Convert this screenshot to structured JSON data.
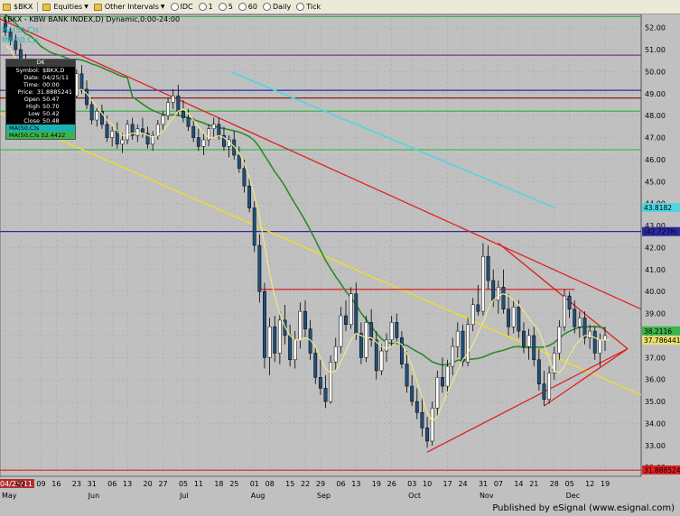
{
  "toolbar": {
    "symbol": "$BKX",
    "equities": "Equities",
    "other_intervals": "Other Intervals",
    "idc": "IDC",
    "i1": "1",
    "i5": "5",
    "i60": "60",
    "daily": "Daily",
    "tick": "Tick"
  },
  "chart_title": "$BKX - KBW BANK INDEX,D) Dynamic,0:00-24:00",
  "ma_labels": [
    "MA(50,C)s",
    "MA(50,C)s"
  ],
  "info_box": {
    "header": "DK",
    "rows": [
      {
        "label": "Symbol:",
        "value": "$BKX,D"
      },
      {
        "label": "Date:",
        "value": "04/25/11"
      },
      {
        "label": "Time:",
        "value": "00:00"
      },
      {
        "label": "Price:",
        "value": "31.8885241"
      },
      {
        "label": "Open",
        "value": "50.47"
      },
      {
        "label": "High",
        "value": "50.70"
      },
      {
        "label": "Low",
        "value": "50.42"
      },
      {
        "label": "Close",
        "value": "50.48"
      }
    ],
    "ma1": "MA(50,C)s",
    "ma2": "MA(50,C)s 52.4422"
  },
  "chart_data": {
    "type": "candlestick",
    "ylim": [
      31.6,
      52.6
    ],
    "y_ticks": [
      52.0,
      51.0,
      50.0,
      49.0,
      48.0,
      47.0,
      46.0,
      45.0,
      44.0,
      43.0,
      42.0,
      41.0,
      40.0,
      39.0,
      38.0,
      37.0,
      36.0,
      35.0,
      34.0,
      33.0,
      32.0
    ],
    "x_ticks": [
      "25",
      "02",
      "09",
      "16",
      "23",
      "31",
      "06",
      "13",
      "20",
      "27",
      "05",
      "11",
      "18",
      "25",
      "01",
      "08",
      "15",
      "22",
      "29",
      "06",
      "13",
      "19",
      "26",
      "03",
      "10",
      "17",
      "24",
      "31",
      "07",
      "14",
      "21",
      "28",
      "05",
      "12",
      "19"
    ],
    "x_tick_date_prefix": "04/25/11",
    "months": [
      {
        "label": "May",
        "tick_index": 0
      },
      {
        "label": "Jun",
        "tick_index": 5
      },
      {
        "label": "Jul",
        "tick_index": 10
      },
      {
        "label": "Aug",
        "tick_index": 14
      },
      {
        "label": "Sep",
        "tick_index": 18
      },
      {
        "label": "Oct",
        "tick_index": 23
      },
      {
        "label": "Nov",
        "tick_index": 27
      },
      {
        "label": "Dec",
        "tick_index": 32
      }
    ],
    "price_tags": [
      {
        "value": 42.7278,
        "label": "(42.7278)",
        "color": "#2a2aa5"
      },
      {
        "value": 38.2116,
        "label": "38.2116",
        "color": "#3bb449"
      },
      {
        "value": 37.786441,
        "label": "37.786441",
        "color": "#e8e070"
      },
      {
        "value": 31.888524,
        "label": "31.888524",
        "color": "#e02020"
      },
      {
        "value": 43.8182,
        "label": "43.8182",
        "color": "#4fd6e0"
      }
    ],
    "horizontal_lines": [
      {
        "value": 52.5,
        "color": "#3bb449"
      },
      {
        "value": 50.75,
        "color": "#7a3a7a"
      },
      {
        "value": 49.15,
        "color": "#2a2aa5"
      },
      {
        "value": 48.8,
        "color": "#8b2020"
      },
      {
        "value": 48.2,
        "color": "#3bb449"
      },
      {
        "value": 46.45,
        "color": "#3bb449"
      },
      {
        "value": 42.73,
        "color": "#2a2aa5"
      },
      {
        "value": 31.88,
        "color": "#e02020"
      }
    ],
    "colors": {
      "up_candle": "#ffffff",
      "down_candle": "#1f4f7a",
      "ma_short": "#f0e68c",
      "ma_long": "#2a8a2a",
      "ma_cyan": "#4fd6e0",
      "trend_red": "#e02020",
      "trend_yellow": "#f0e020",
      "plot_bg": "#c0c0c0",
      "grid": "#a8a8a8"
    },
    "candles": [
      [
        52.2,
        52.6,
        51.6,
        51.8
      ],
      [
        51.8,
        52.0,
        51.2,
        51.4
      ],
      [
        51.4,
        51.7,
        50.8,
        51.0
      ],
      [
        51.0,
        51.3,
        50.2,
        50.4
      ],
      [
        50.4,
        50.8,
        49.7,
        50.0
      ],
      [
        50.0,
        50.6,
        49.4,
        50.3
      ],
      [
        50.3,
        50.5,
        49.0,
        49.2
      ],
      [
        49.2,
        49.6,
        48.4,
        48.7
      ],
      [
        48.7,
        49.3,
        48.3,
        49.0
      ],
      [
        49.0,
        49.4,
        48.6,
        48.8
      ],
      [
        48.8,
        49.5,
        48.6,
        49.3
      ],
      [
        49.3,
        49.8,
        48.9,
        49.1
      ],
      [
        49.1,
        49.6,
        48.5,
        48.6
      ],
      [
        48.6,
        49.1,
        48.2,
        48.9
      ],
      [
        48.9,
        50.1,
        48.8,
        49.9
      ],
      [
        49.9,
        50.3,
        49.0,
        49.2
      ],
      [
        49.2,
        49.6,
        48.3,
        48.5
      ],
      [
        48.5,
        48.8,
        47.6,
        47.8
      ],
      [
        47.8,
        48.4,
        47.5,
        48.2
      ],
      [
        48.2,
        48.5,
        47.4,
        47.6
      ],
      [
        47.6,
        48.0,
        46.8,
        47.0
      ],
      [
        47.0,
        47.5,
        46.6,
        47.3
      ],
      [
        47.3,
        47.7,
        46.5,
        46.7
      ],
      [
        46.7,
        47.2,
        46.3,
        46.9
      ],
      [
        46.9,
        47.8,
        46.7,
        47.6
      ],
      [
        47.6,
        47.9,
        46.9,
        47.1
      ],
      [
        47.1,
        47.6,
        46.8,
        47.4
      ],
      [
        47.4,
        47.9,
        47.0,
        47.2
      ],
      [
        47.2,
        47.5,
        46.5,
        46.7
      ],
      [
        46.7,
        47.3,
        46.4,
        47.1
      ],
      [
        47.1,
        47.8,
        46.9,
        47.6
      ],
      [
        47.6,
        48.2,
        47.3,
        48.0
      ],
      [
        48.0,
        48.8,
        47.8,
        48.6
      ],
      [
        48.6,
        49.2,
        48.3,
        48.9
      ],
      [
        48.9,
        49.4,
        48.0,
        48.2
      ],
      [
        48.2,
        48.7,
        47.7,
        47.9
      ],
      [
        47.9,
        48.3,
        47.3,
        47.5
      ],
      [
        47.5,
        47.9,
        46.8,
        47.0
      ],
      [
        47.0,
        47.4,
        46.4,
        46.6
      ],
      [
        46.6,
        47.2,
        46.2,
        46.9
      ],
      [
        46.9,
        47.6,
        46.6,
        47.4
      ],
      [
        47.4,
        47.9,
        47.0,
        47.6
      ],
      [
        47.6,
        47.9,
        46.9,
        47.1
      ],
      [
        47.1,
        47.5,
        46.4,
        46.6
      ],
      [
        46.6,
        47.1,
        46.1,
        46.9
      ],
      [
        46.9,
        47.3,
        46.0,
        46.2
      ],
      [
        46.2,
        46.6,
        45.4,
        45.6
      ],
      [
        45.6,
        46.0,
        44.5,
        44.8
      ],
      [
        44.8,
        45.2,
        43.6,
        43.8
      ],
      [
        43.8,
        44.1,
        41.8,
        42.1
      ],
      [
        42.1,
        42.6,
        39.5,
        40.0
      ],
      [
        40.0,
        40.4,
        36.5,
        37.0
      ],
      [
        37.0,
        38.8,
        36.2,
        38.4
      ],
      [
        38.4,
        38.9,
        36.8,
        37.2
      ],
      [
        37.2,
        39.1,
        36.7,
        38.7
      ],
      [
        38.7,
        39.4,
        37.6,
        38.0
      ],
      [
        38.0,
        38.5,
        36.6,
        36.9
      ],
      [
        36.9,
        38.2,
        36.5,
        37.8
      ],
      [
        37.8,
        39.5,
        37.4,
        39.1
      ],
      [
        39.1,
        39.6,
        37.9,
        38.3
      ],
      [
        38.3,
        38.7,
        36.9,
        37.2
      ],
      [
        37.2,
        37.5,
        35.8,
        36.1
      ],
      [
        36.1,
        36.9,
        35.3,
        35.6
      ],
      [
        35.6,
        36.2,
        34.7,
        35.0
      ],
      [
        35.0,
        37.1,
        34.9,
        36.8
      ],
      [
        36.8,
        37.9,
        36.4,
        37.5
      ],
      [
        37.5,
        39.3,
        37.2,
        38.9
      ],
      [
        38.9,
        39.6,
        38.2,
        38.5
      ],
      [
        38.5,
        40.2,
        38.3,
        39.9
      ],
      [
        39.9,
        40.4,
        37.8,
        38.1
      ],
      [
        38.1,
        38.6,
        36.7,
        37.0
      ],
      [
        37.0,
        38.9,
        36.8,
        38.6
      ],
      [
        38.6,
        39.2,
        37.5,
        37.8
      ],
      [
        37.8,
        38.2,
        36.0,
        36.4
      ],
      [
        36.4,
        37.6,
        36.2,
        37.3
      ],
      [
        37.3,
        38.1,
        36.8,
        37.8
      ],
      [
        37.8,
        38.9,
        37.5,
        38.6
      ],
      [
        38.6,
        39.0,
        37.6,
        37.9
      ],
      [
        37.9,
        38.2,
        36.5,
        36.7
      ],
      [
        36.7,
        37.3,
        35.4,
        35.7
      ],
      [
        35.7,
        36.2,
        34.8,
        35.0
      ],
      [
        35.0,
        35.6,
        34.2,
        34.5
      ],
      [
        34.5,
        35.2,
        33.4,
        33.8
      ],
      [
        33.8,
        34.3,
        32.9,
        33.2
      ],
      [
        33.2,
        35.0,
        33.0,
        34.7
      ],
      [
        34.7,
        36.4,
        34.3,
        36.1
      ],
      [
        36.1,
        37.0,
        35.4,
        35.7
      ],
      [
        35.7,
        36.9,
        35.3,
        36.6
      ],
      [
        36.6,
        37.9,
        36.2,
        37.5
      ],
      [
        37.5,
        38.6,
        37.0,
        38.2
      ],
      [
        38.2,
        38.5,
        36.6,
        36.8
      ],
      [
        36.8,
        38.8,
        36.6,
        38.5
      ],
      [
        38.5,
        39.7,
        38.2,
        39.4
      ],
      [
        39.4,
        40.3,
        38.9,
        39.1
      ],
      [
        39.1,
        42.2,
        38.9,
        41.6
      ],
      [
        41.6,
        42.1,
        40.1,
        40.5
      ],
      [
        40.5,
        41.0,
        39.3,
        39.6
      ],
      [
        39.6,
        40.5,
        39.0,
        40.2
      ],
      [
        40.2,
        41.0,
        39.0,
        39.2
      ],
      [
        39.2,
        39.9,
        38.0,
        38.4
      ],
      [
        38.4,
        39.6,
        38.1,
        39.3
      ],
      [
        39.3,
        39.6,
        37.9,
        38.2
      ],
      [
        38.2,
        38.6,
        37.2,
        37.5
      ],
      [
        37.5,
        38.3,
        36.9,
        38.0
      ],
      [
        38.0,
        38.4,
        36.6,
        36.9
      ],
      [
        36.9,
        37.4,
        35.5,
        35.8
      ],
      [
        35.8,
        36.4,
        34.8,
        35.1
      ],
      [
        35.1,
        36.6,
        34.9,
        36.3
      ],
      [
        36.3,
        37.5,
        36.0,
        37.2
      ],
      [
        37.2,
        38.7,
        36.9,
        38.4
      ],
      [
        38.4,
        40.1,
        38.2,
        39.8
      ],
      [
        39.8,
        40.0,
        38.8,
        39.2
      ],
      [
        39.2,
        39.6,
        38.1,
        38.4
      ],
      [
        38.4,
        39.1,
        37.9,
        38.8
      ],
      [
        38.8,
        39.1,
        37.6,
        37.9
      ],
      [
        37.9,
        38.5,
        37.4,
        38.2
      ],
      [
        38.2,
        38.4,
        36.9,
        37.2
      ],
      [
        37.2,
        38.1,
        36.6,
        37.8
      ],
      [
        37.8,
        38.4,
        37.3,
        38.0
      ]
    ],
    "ma_short": [
      51.2,
      51.0,
      50.6,
      50.2,
      49.9,
      49.8,
      49.6,
      49.3,
      49.1,
      49.0,
      49.0,
      49.1,
      49.0,
      48.9,
      49.1,
      49.2,
      49.0,
      48.7,
      48.4,
      48.1,
      47.8,
      47.6,
      47.3,
      47.1,
      47.1,
      47.2,
      47.2,
      47.2,
      47.1,
      47.0,
      47.1,
      47.3,
      47.6,
      47.9,
      48.2,
      48.3,
      48.1,
      47.8,
      47.5,
      47.2,
      47.0,
      47.0,
      47.1,
      47.0,
      46.8,
      46.6,
      46.3,
      45.8,
      45.2,
      44.4,
      43.4,
      42.1,
      40.8,
      39.8,
      39.0,
      38.4,
      38.0,
      37.8,
      37.8,
      37.9,
      37.8,
      37.5,
      37.0,
      36.5,
      36.3,
      36.4,
      36.8,
      37.3,
      37.8,
      38.1,
      38.0,
      37.9,
      37.9,
      37.7,
      37.5,
      37.4,
      37.5,
      37.7,
      37.6,
      37.2,
      36.6,
      35.9,
      35.2,
      34.5,
      34.1,
      34.3,
      34.9,
      35.4,
      35.9,
      36.4,
      36.9,
      37.2,
      37.6,
      38.1,
      38.6,
      39.2,
      39.6,
      39.8,
      39.9,
      39.8,
      39.6,
      39.4,
      39.1,
      38.8,
      38.5,
      38.2,
      37.6,
      36.9,
      36.4,
      36.3,
      36.6,
      37.1,
      37.5,
      37.8,
      38.0,
      38.0,
      37.9,
      37.8,
      37.8,
      37.8
    ]
  }
}
